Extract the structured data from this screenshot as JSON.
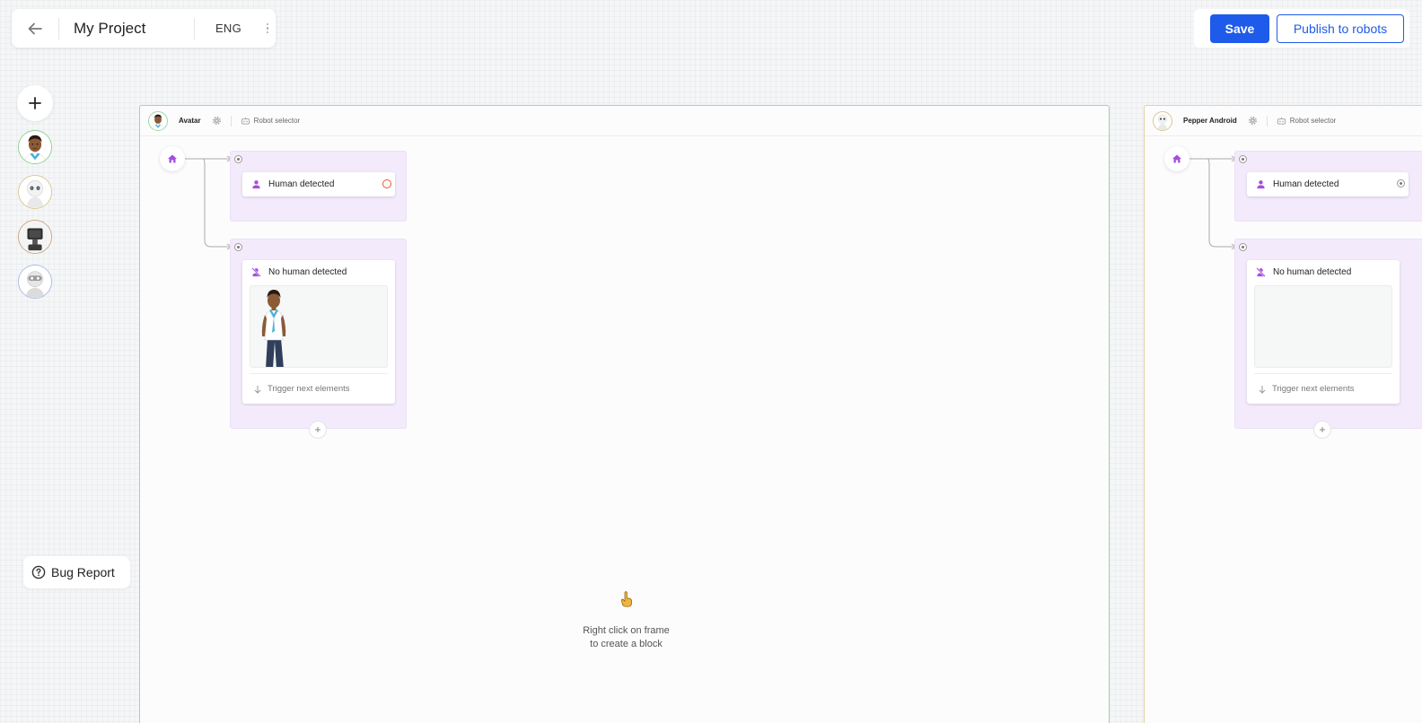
{
  "header": {
    "project_title": "My Project",
    "language": "ENG",
    "save_label": "Save",
    "publish_label": "Publish to robots"
  },
  "sidebar": {
    "robots": [
      {
        "name": "avatar-robot",
        "border": "#8fd196"
      },
      {
        "name": "pepper-robot",
        "border": "#dcc791"
      },
      {
        "name": "kiosk-robot",
        "border": "#c9a78a"
      },
      {
        "name": "nao-robot",
        "border": "#a9bde8"
      }
    ]
  },
  "bug_report": {
    "label": "Bug Report"
  },
  "frames": [
    {
      "robot_name": "Avatar",
      "selector_label": "Robot selector",
      "blocks": [
        {
          "title": "Human detected"
        },
        {
          "title": "No human detected",
          "footer": "Trigger next elements"
        }
      ],
      "hint_line1": "Right click on frame",
      "hint_line2": "to create a block"
    },
    {
      "robot_name": "Pepper Android",
      "selector_label": "Robot selector",
      "blocks": [
        {
          "title": "Human detected"
        },
        {
          "title": "No human detected",
          "footer": "Trigger next elements"
        }
      ]
    }
  ],
  "colors": {
    "accent": "#1f5bea",
    "block_icon": "#a64ee0",
    "lane_bg": "#f3ebfb",
    "frame1_border": "#9fd7a5",
    "frame2_border": "#e2d3a0",
    "status_error": "#e8562f"
  },
  "icons": {
    "back": "arrow-left-icon",
    "menu": "kebab-menu-icon",
    "add": "plus-icon",
    "help": "question-circle-icon",
    "gear": "gear-icon",
    "robot": "robot-icon",
    "home": "home-icon",
    "human": "person-icon",
    "no_human": "person-off-icon",
    "trigger": "arrow-down-icon",
    "pointer": "pointing-up-hand-icon"
  }
}
